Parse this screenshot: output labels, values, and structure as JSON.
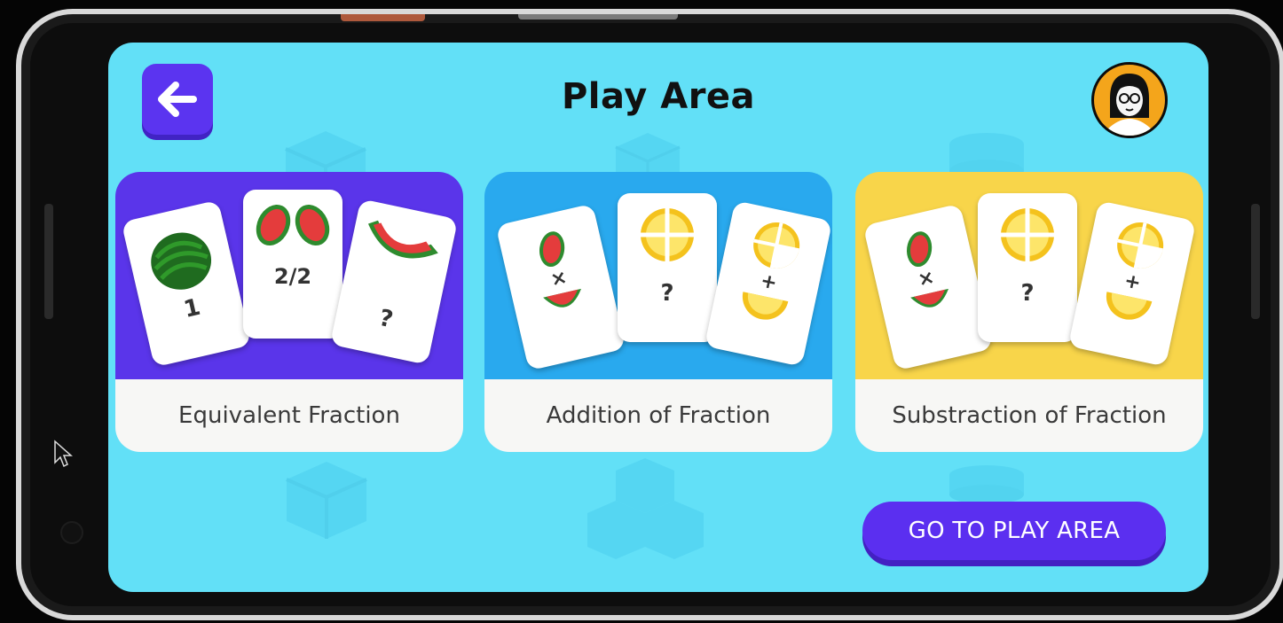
{
  "header": {
    "title": "Play Area"
  },
  "cards": [
    {
      "label": "Equivalent Fraction",
      "mini_cards": [
        "1",
        "2/2",
        "?"
      ],
      "color": "#5a35ea"
    },
    {
      "label": "Addition of Fraction",
      "mini_cards": [
        "×",
        "?",
        "+"
      ],
      "color": "#29a9ee"
    },
    {
      "label": "Substraction of Fraction",
      "mini_cards": [
        "×",
        "?",
        "+"
      ],
      "color": "#f8d54a"
    }
  ],
  "actions": {
    "go_label": "GO TO PLAY AREA"
  },
  "icons": {
    "back": "arrow-left-icon",
    "avatar": "user-avatar-icon"
  },
  "colors": {
    "screen_bg": "#62e0f7",
    "primary_button": "#5b2ff0"
  }
}
